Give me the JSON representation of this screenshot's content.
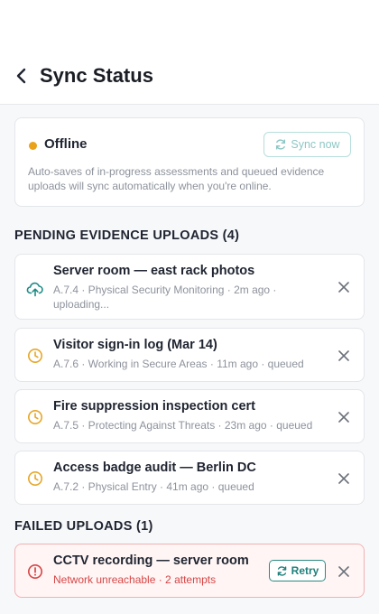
{
  "header": {
    "title": "Sync Status",
    "back_icon": "chevron-left-icon"
  },
  "status": {
    "state": "Offline",
    "dot_color": "#eaa21b",
    "sync_button_label": "Sync now",
    "sync_button_enabled": false,
    "description": "Auto-saves of in-progress assessments and queued evidence uploads will sync automatically when you're online."
  },
  "pending": {
    "heading": "PENDING EVIDENCE UPLOADS (4)",
    "items": [
      {
        "title": "Server room — east rack photos",
        "meta_line1": "A.7.4 · Physical Security Monitoring · 2m ago ·",
        "meta_line2": "uploading...",
        "icon": "cloud-upload-icon",
        "icon_color": "#1e8a84"
      },
      {
        "title": "Visitor sign-in log (Mar 14)",
        "meta_line1": "A.7.6 · Working in Secure Areas · 11m ago · queued",
        "icon": "clock-icon",
        "icon_color": "#e6a72a"
      },
      {
        "title": "Fire suppression inspection cert",
        "meta_line1": "A.7.5 · Protecting Against Threats · 23m ago · queued",
        "icon": "clock-icon",
        "icon_color": "#e6a72a"
      },
      {
        "title": "Access badge audit — Berlin DC",
        "meta_line1": "A.7.2 · Physical Entry · 41m ago · queued",
        "icon": "clock-icon",
        "icon_color": "#e6a72a"
      }
    ]
  },
  "failed": {
    "heading": "FAILED UPLOADS (1)",
    "items": [
      {
        "title": "CCTV recording — server room",
        "meta_line1": "Network unreachable · 2 attempts",
        "icon": "alert-circle-icon",
        "icon_color": "#d64545",
        "retry_label": "Retry"
      }
    ]
  }
}
